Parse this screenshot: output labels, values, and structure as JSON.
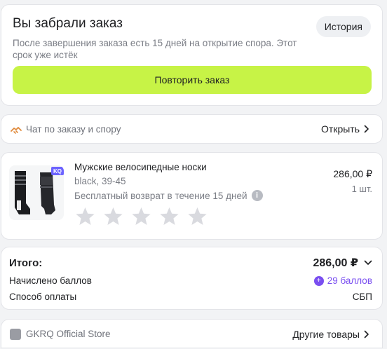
{
  "status": {
    "title": "Вы забрали заказ",
    "description": "После завершения заказа есть 15 дней на открытие спора. Этот срок уже истёк",
    "history_label": "История",
    "repeat_label": "Повторить заказ"
  },
  "chat": {
    "label": "Чат по заказу и спору",
    "open_label": "Открыть"
  },
  "product": {
    "name": "Мужские велосипедные носки",
    "variant": "black, 39-45",
    "return_note": "Бесплатный возврат в течение 15 дней",
    "price": "286,00 ₽",
    "quantity": "1 шт.",
    "rating": 0,
    "max_rating": 5,
    "image_badge": "KQ"
  },
  "totals": {
    "total_label": "Итого:",
    "total_value": "286,00 ₽",
    "points_label": "Начислено баллов",
    "points_value": "29 баллов",
    "payment_label": "Способ оплаты",
    "payment_value": "СБП"
  },
  "store": {
    "name": "GKRQ Official Store",
    "other_label": "Другие товары"
  },
  "colors": {
    "accent_button": "#c7f346",
    "points": "#7a4ff0",
    "star_empty": "#d9dadf"
  }
}
